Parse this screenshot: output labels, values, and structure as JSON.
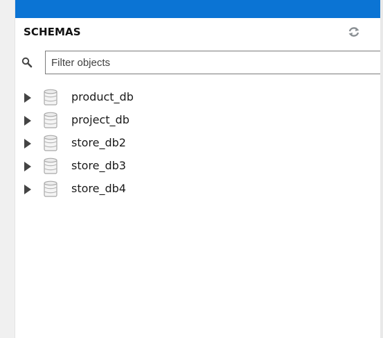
{
  "panel": {
    "title": "SCHEMAS",
    "filter_placeholder": "Filter objects",
    "schemas": [
      {
        "label": "product_db"
      },
      {
        "label": "project_db"
      },
      {
        "label": "store_db2"
      },
      {
        "label": "store_db3"
      },
      {
        "label": "store_db4"
      }
    ],
    "icons": {
      "refresh": "refresh-icon",
      "search": "search-icon",
      "expand": "expand-arrow-icon",
      "schema": "database-icon"
    },
    "colors": {
      "top_bar": "#0b74d4",
      "icon_gray": "#9a9a9a"
    }
  }
}
